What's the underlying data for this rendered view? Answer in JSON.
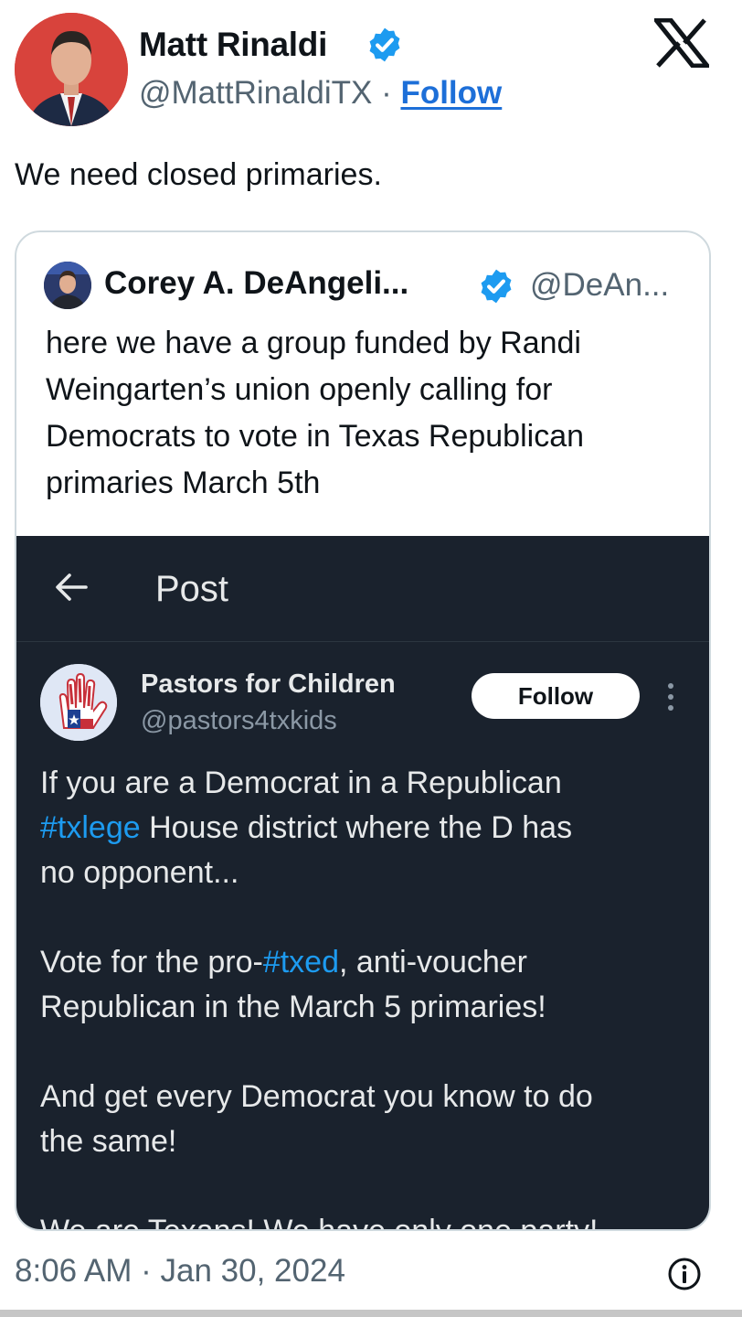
{
  "author": {
    "name": "Matt Rinaldi",
    "handle": "@MattRinaldiTX",
    "separator": "·",
    "follow_label": "Follow",
    "avatar_icon": "person-avatar"
  },
  "tweet": {
    "text": "We need closed primaries."
  },
  "quote": {
    "name": "Corey A. DeAngeli...",
    "handle": "@DeAn...",
    "text": "here we have a group funded by Randi Weingarten’s union openly calling for Democrats to vote in Texas Republican primaries March 5th",
    "embedded_post": {
      "header_title": "Post",
      "account_name": "Pastors for Children",
      "account_handle": "@pastors4txkids",
      "follow_label": "Follow",
      "paragraph1_a": "If you are a Democrat in a Republican\n",
      "paragraph1_tag": "#txlege",
      "paragraph1_b": " House district where the D has\nno opponent...",
      "paragraph2_a": "Vote for the pro-",
      "paragraph2_tag": "#txed",
      "paragraph2_b": ", anti-voucher\nRepublican in the March 5 primaries!",
      "paragraph3": "And get every Democrat you know to do\nthe same!",
      "paragraph4": "We are Texans! We have only one party!"
    }
  },
  "footer": {
    "timestamp": "8:06 AM · Jan 30, 2024",
    "info_icon": "info-icon"
  },
  "colors": {
    "verified_blue": "#1d9bf0",
    "link_blue": "#1d6fd8",
    "embed_background": "#1a222d",
    "hashtag_blue": "#1d9bf0"
  }
}
